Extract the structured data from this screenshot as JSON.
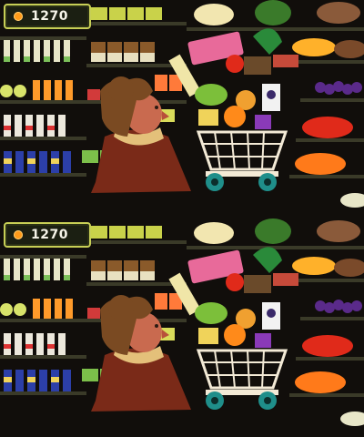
{
  "game": {
    "panels": [
      {
        "id": "top",
        "score": "1270"
      },
      {
        "id": "bottom",
        "score": "1270"
      }
    ]
  },
  "icons": {
    "coin": "coin-icon"
  },
  "colors": {
    "background": "#110e0b",
    "hud_border": "#c7cf56",
    "coin": "#ff9a1a",
    "score_text": "#f5f3e8",
    "cart": "#f3ead6",
    "cart_wheels": "#1f8e8a",
    "shopper_hair": "#7a4a22",
    "shopper_skin": "#c96a4f",
    "shopper_coat": "#7a2a18"
  }
}
